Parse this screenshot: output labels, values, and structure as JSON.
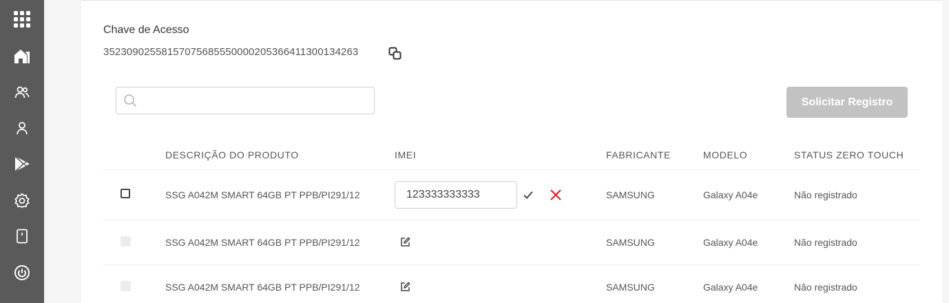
{
  "sidebar": {
    "items": [
      {
        "icon": "grid-icon"
      },
      {
        "icon": "home-icon"
      },
      {
        "icon": "users-icon"
      },
      {
        "icon": "user-icon"
      },
      {
        "icon": "play-store-icon"
      },
      {
        "icon": "settings-icon"
      },
      {
        "icon": "device-icon"
      },
      {
        "icon": "power-icon"
      }
    ],
    "background": "#5a5a5a"
  },
  "access_key": {
    "label": "Chave de Acesso",
    "value": "35230902558157075685550000205366411300134263"
  },
  "search": {
    "placeholder": "",
    "value": ""
  },
  "solicitar_button": {
    "label": "Solicitar Registro",
    "color": "#c2c2c2"
  },
  "table": {
    "headers": [
      "DESCRIÇÃO DO PRODUTO",
      "IMEI",
      "FABRICANTE",
      "MODELO",
      "STATUS ZERO TOUCH"
    ],
    "rows": [
      {
        "description": "SSG A042M SMART 64GB PT PPB/PI291/12",
        "imei": "123333333333",
        "editing": true,
        "manufacturer": "SAMSUNG",
        "model": "Galaxy A04e",
        "status": "Não registrado"
      },
      {
        "description": "SSG A042M SMART 64GB PT PPB/PI291/12",
        "imei": "",
        "editing": false,
        "manufacturer": "SAMSUNG",
        "model": "Galaxy A04e",
        "status": "Não registrado"
      },
      {
        "description": "SSG A042M SMART 64GB PT PPB/PI291/12",
        "imei": "",
        "editing": false,
        "manufacturer": "SAMSUNG",
        "model": "Galaxy A04e",
        "status": "Não registrado"
      }
    ]
  },
  "colors": {
    "cancel": "#e02020",
    "confirm": "#444444"
  }
}
